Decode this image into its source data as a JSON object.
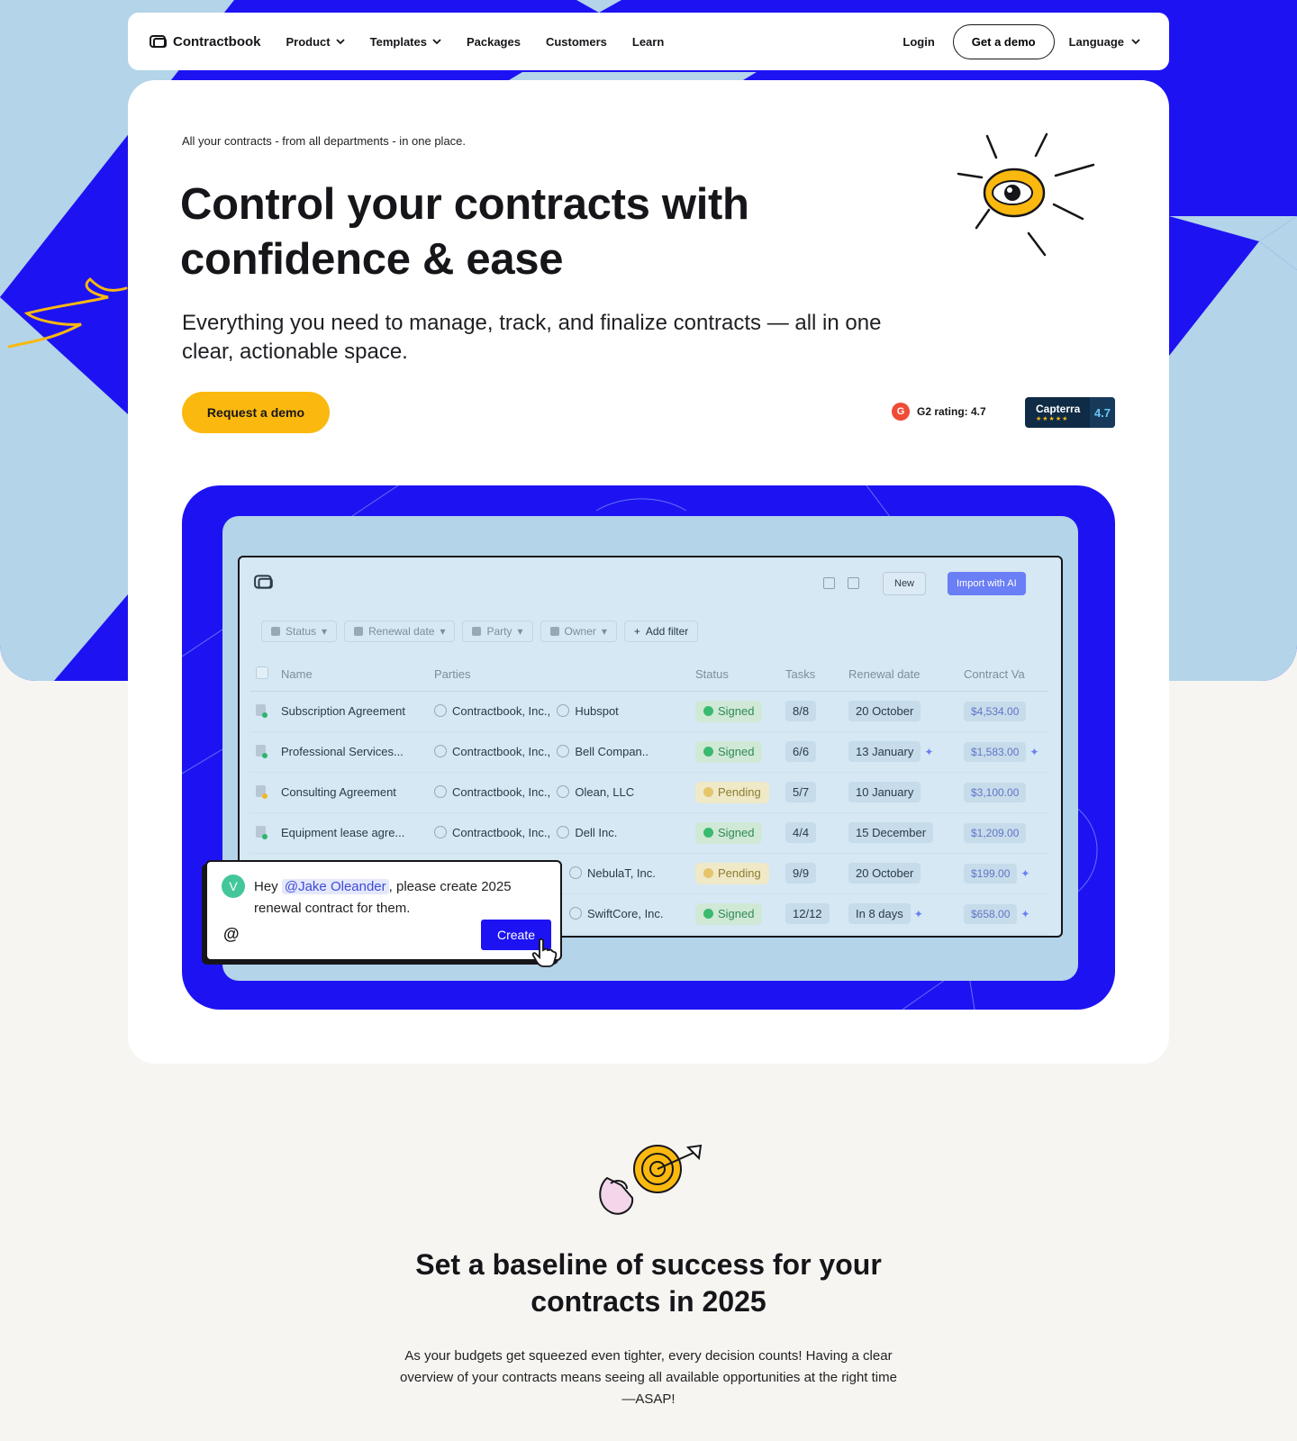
{
  "nav": {
    "brand": "Contractbook",
    "items": [
      {
        "label": "Product",
        "dropdown": true
      },
      {
        "label": "Templates",
        "dropdown": true
      },
      {
        "label": "Packages",
        "dropdown": false
      },
      {
        "label": "Customers",
        "dropdown": false
      },
      {
        "label": "Learn",
        "dropdown": false
      }
    ],
    "login": "Login",
    "demo": "Get a demo",
    "language": "Language"
  },
  "hero": {
    "kicker": "All your contracts - from all departments - in one place.",
    "title": "Control your contracts with confidence & ease",
    "lead": "Everything you need to manage, track, and finalize contracts — all in one clear, actionable space.",
    "cta": "Request a demo",
    "g2_icon": "G",
    "g2": "G2 rating: 4.7",
    "capterra_name": "Capterra",
    "capterra_stars": "★★★★★",
    "capterra_score": "4.7"
  },
  "app": {
    "new_button": "New",
    "import_button": "Import with AI",
    "filters": [
      "Status",
      "Renewal date",
      "Party",
      "Owner"
    ],
    "add_filter": "Add filter",
    "columns": [
      "Name",
      "Parties",
      "Status",
      "Tasks",
      "Renewal date",
      "Contract Va"
    ],
    "rows": [
      {
        "name": "Subscription Agreement",
        "party1": "Contractbook, Inc.,",
        "party2": "Hubspot",
        "status": "Signed",
        "tasks": "8/8",
        "renewal": "20 October",
        "value": "$4,534.00"
      },
      {
        "name": "Professional Services...",
        "party1": "Contractbook, Inc.,",
        "party2": "Bell Compan..",
        "status": "Signed",
        "tasks": "6/6",
        "renewal": "13 January",
        "value": "$1,583.00"
      },
      {
        "name": "Consulting Agreement",
        "party1": "Contractbook, Inc.,",
        "party2": "Olean, LLC",
        "status": "Pending",
        "tasks": "5/7",
        "renewal": "10 January",
        "value": "$3,100.00"
      },
      {
        "name": "Equipment lease agre...",
        "party1": "Contractbook, Inc.,",
        "party2": "Dell Inc.",
        "status": "Signed",
        "tasks": "4/4",
        "renewal": "15 December",
        "value": "$1,209.00"
      },
      {
        "name": "",
        "party1": "",
        "party2": "NebulaT, Inc.",
        "status": "Pending",
        "tasks": "9/9",
        "renewal": "20 October",
        "value": "$199.00"
      },
      {
        "name": "",
        "party1": "",
        "party2": "SwiftCore, Inc.",
        "status": "Signed",
        "tasks": "12/12",
        "renewal": "In 8 days",
        "value": "$658.00"
      }
    ],
    "comment": {
      "avatar": "V",
      "hey": "Hey",
      "mention": "@Jake Oleander",
      "rest": ", please create 2025 renewal contract for them.",
      "at": "@",
      "create": "Create"
    }
  },
  "section2": {
    "title": "Set a baseline of success for your contracts in 2025",
    "body": "As your budgets get squeezed even tighter, every decision counts! Having a clear overview of your contracts means seeing all available opportunities at the right time—ASAP!"
  },
  "colors": {
    "brand_blue": "#1d13f2",
    "light_blue": "#b3d4e9",
    "accent_yellow": "#fbb80f",
    "page_bg": "#f6f5f1"
  }
}
